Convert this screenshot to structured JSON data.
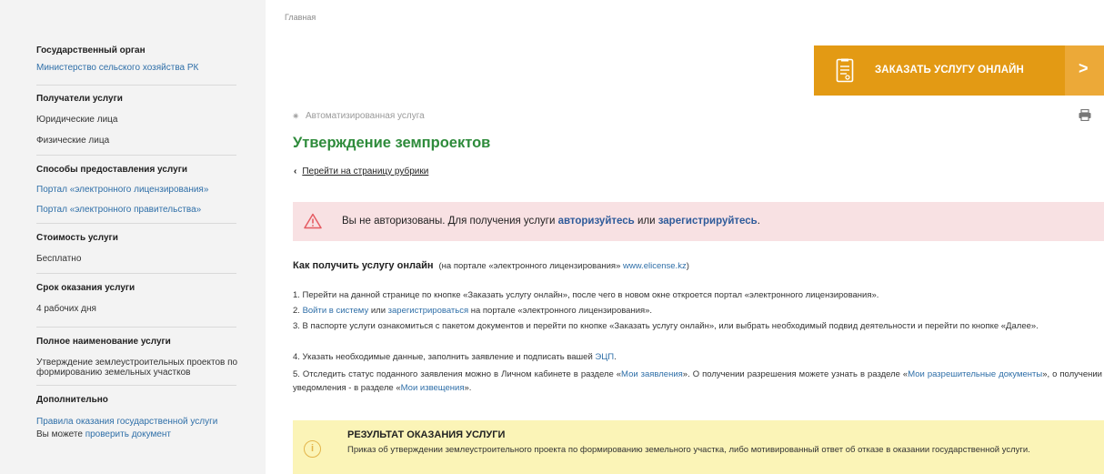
{
  "breadcrumb": "Главная",
  "sidebar": {
    "sections": [
      {
        "title": "Государственный орган",
        "items": [
          {
            "text": "Министерство сельского хозяйства РК",
            "link": true
          }
        ]
      },
      {
        "title": "Получатели услуги",
        "items": [
          {
            "text": "Юридические лица",
            "link": false
          },
          {
            "text": "Физические лица",
            "link": false
          }
        ]
      },
      {
        "title": "Способы предоставления услуги",
        "items": [
          {
            "text": "Портал «электронного лицензирования»",
            "link": true
          },
          {
            "text": "Портал «электронного правительства»",
            "link": true
          }
        ]
      },
      {
        "title": "Стоимость услуги",
        "items": [
          {
            "text": "Бесплатно",
            "link": false
          }
        ]
      },
      {
        "title": "Срок оказания услуги",
        "items": [
          {
            "text": "4 рабочих дня",
            "link": false
          }
        ]
      },
      {
        "title": "Полное наименование услуги",
        "items": [
          {
            "text": "Утверждение землеустроительных проектов по формированию земельных участков",
            "link": false
          }
        ]
      },
      {
        "title": "Дополнительно",
        "items": [
          {
            "text": "Правила оказания государственной услуги",
            "link": true
          }
        ]
      }
    ],
    "extra_prefix": "Вы можете ",
    "extra_link": "проверить документ"
  },
  "order_button": {
    "label": "ЗАКАЗАТЬ УСЛУГУ ОНЛАЙН",
    "arrow": ">"
  },
  "service_type": "Автоматизированная услуга",
  "title": "Утверждение земпроектов",
  "back_link": "Перейти на страницу рубрики",
  "alert": {
    "prefix": "Вы не авторизованы. Для получения услуги ",
    "link1": "авторизуйтесь",
    "middle": " или ",
    "link2": "зарегистрируйтесь",
    "suffix": "."
  },
  "howto": {
    "heading": "Как получить услугу онлайн",
    "note_prefix": "(на портале «электронного лицензирования» ",
    "note_url": "www.elicense.kz",
    "note_suffix": ")"
  },
  "steps": {
    "s1": "1. Перейти на данной странице по кнопке «Заказать услугу онлайн», после чего в новом окне откроется портал «электронного лицензирования».",
    "s2_num": "2. ",
    "s2_link1": "Войти в систему",
    "s2_mid": " или ",
    "s2_link2": "зарегистрироваться",
    "s2_end": " на портале «электронного лицензирования».",
    "s3": "3. В паспорте услуги ознакомиться с пакетом документов и перейти по кнопке «Заказать услугу онлайн», или выбрать необходимый подвид деятельности и перейти по кнопке «Далее».",
    "s4_text": "4. Указать необходимые данные, заполнить заявление и подписать вашей ",
    "s4_link": "ЭЦП",
    "s4_end": ".",
    "s5_a": "5. Отследить статус поданного заявления можно в Личном кабинете в разделе «",
    "s5_link1": "Мои заявления",
    "s5_b": "». О получении разрешения можете узнать в разделе «",
    "s5_link2": "Мои разрешительные документы",
    "s5_c": "», о получении уведомления - в разделе «",
    "s5_link3": "Мои извещения",
    "s5_d": "»."
  },
  "result": {
    "title": "РЕЗУЛЬТАТ ОКАЗАНИЯ УСЛУГИ",
    "text": "Приказ об утверждении землеустроительного проекта по формированию земельного участка, либо мотивированный ответ об отказе в оказании государственной услуги."
  },
  "colors": {
    "accent": "#e39a14",
    "title_green": "#2e8b3b",
    "link": "#2f6fa8",
    "alert_bg": "#f8e1e3",
    "result_bg": "#fbf4b7"
  },
  "icons": [
    "document-icon",
    "gear-icon",
    "print-icon",
    "warning-icon",
    "info-icon",
    "chevron-left-icon",
    "chevron-right-icon"
  ]
}
